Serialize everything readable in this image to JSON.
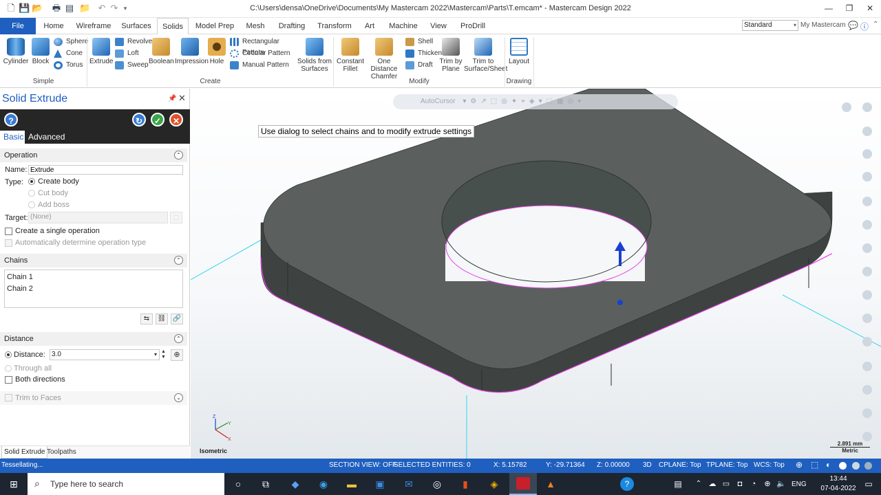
{
  "window": {
    "title": "C:\\Users\\densa\\OneDrive\\Documents\\My Mastercam 2022\\Mastercam\\Parts\\T.emcam* - Mastercam Design 2022",
    "workspace_select": "Standard",
    "account_label": "My Mastercam"
  },
  "tabs": [
    "File",
    "Home",
    "Wireframe",
    "Surfaces",
    "Solids",
    "Model Prep",
    "Mesh",
    "Drafting",
    "Transform",
    "Art",
    "Machine",
    "View",
    "ProDrill"
  ],
  "ribbon": {
    "simple": {
      "label": "Simple",
      "cylinder": "Cylinder",
      "block": "Block",
      "sphere": "Sphere",
      "cone": "Cone",
      "torus": "Torus"
    },
    "create": {
      "label": "Create",
      "extrude": "Extrude",
      "revolve": "Revolve",
      "loft": "Loft",
      "sweep": "Sweep",
      "boolean": "Boolean",
      "impression": "Impression",
      "hole": "Hole",
      "rect_pattern": "Rectangular Pattern",
      "circ_pattern": "Circular Pattern",
      "manual_pattern": "Manual Pattern",
      "solids_from_surfaces_1": "Solids from",
      "solids_from_surfaces_2": "Surfaces"
    },
    "modify": {
      "label": "Modify",
      "constant_fillet_1": "Constant",
      "constant_fillet_2": "Fillet",
      "one_distance_1": "One Distance",
      "one_distance_2": "Chamfer",
      "shell": "Shell",
      "thicken": "Thicken",
      "draft": "Draft",
      "trim_plane_1": "Trim by",
      "trim_plane_2": "Plane",
      "trim_surface_1": "Trim to",
      "trim_surface_2": "Surface/Sheet"
    },
    "drawing": {
      "label": "Drawing",
      "layout": "Layout"
    }
  },
  "panel": {
    "title": "Solid Extrude",
    "subtabs": {
      "basic": "Basic",
      "advanced": "Advanced"
    },
    "operation": {
      "header": "Operation",
      "name_label": "Name:",
      "name_value": "Extrude",
      "type_label": "Type:",
      "create_body": "Create body",
      "cut_body": "Cut body",
      "add_boss": "Add boss",
      "target_label": "Target:",
      "target_value": "(None)",
      "single_op": "Create a single operation",
      "auto_type": "Automatically determine operation type"
    },
    "chains": {
      "header": "Chains",
      "items": [
        "Chain  1",
        "Chain  2"
      ]
    },
    "distance": {
      "header": "Distance",
      "distance_label": "Distance:",
      "distance_value": "3.0",
      "through_all": "Through all",
      "both_directions": "Both directions",
      "trim_to_faces": "Trim to Faces"
    },
    "bottom_tabs": [
      "Solid Extrude",
      "Toolpaths"
    ]
  },
  "viewport": {
    "autocursor": "AutoCursor",
    "prompt": "Use dialog to select chains and to modify extrude settings",
    "view_name": "Isometric",
    "scale_value": "2.891 mm",
    "scale_unit": "Metric",
    "axis_x": "X",
    "axis_y": "Y",
    "axis_z": "Z"
  },
  "statusbar": {
    "message": "Tessellating...",
    "section_view": "SECTION VIEW: OFF",
    "selected": "SELECTED ENTITIES: 0",
    "x": "X:   5.15782",
    "y": "Y:   -29.71364",
    "z": "Z:   0.00000",
    "mode": "3D",
    "cplane": "CPLANE: Top",
    "tplane": "TPLANE: Top",
    "wcs": "WCS: Top"
  },
  "taskbar": {
    "search_placeholder": "Type here to search",
    "lang": "ENG",
    "time": "13:44",
    "date": "07-04-2022"
  }
}
